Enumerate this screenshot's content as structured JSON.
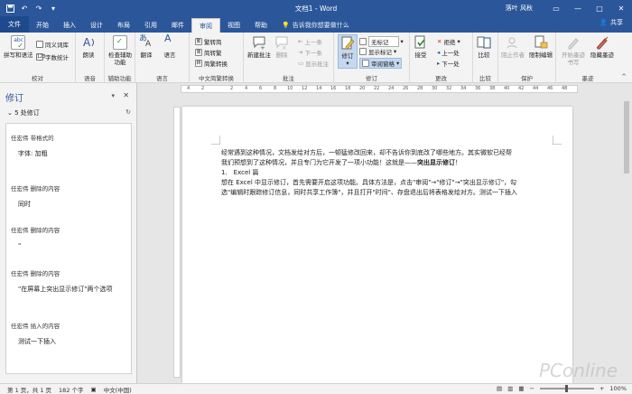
{
  "window": {
    "title": "文档1 - Word",
    "user": "落叶 风秋",
    "share_label": "共享",
    "tell_me": "告诉我你想要做什么"
  },
  "tabs": [
    "文件",
    "开始",
    "插入",
    "设计",
    "布局",
    "引用",
    "邮件",
    "审阅",
    "视图",
    "帮助"
  ],
  "active_tab": "审阅",
  "ribbon": {
    "proofing": {
      "name": "校对",
      "spelling": "拼写和语法",
      "thesaurus": "同义词库",
      "wordcount": "字数统计"
    },
    "speech": {
      "name": "语音",
      "read_aloud": "朗读"
    },
    "accessibility": {
      "name": "辅助功能",
      "check": "检查辅助功能"
    },
    "language": {
      "name": "语言",
      "translate": "翻译",
      "language": "语言"
    },
    "chinese": {
      "name": "中文简繁转换",
      "to_trad": "繁转简",
      "to_simp": "简转繁",
      "convert": "简繁转换"
    },
    "comments": {
      "name": "批注",
      "new": "新建批注",
      "delete": "删除",
      "prev": "上一条",
      "next": "下一条",
      "show": "显示批注"
    },
    "tracking": {
      "name": "修订",
      "track": "修订",
      "markup_select": "无标记",
      "show_markup": "显示标记",
      "pane": "审阅窗格"
    },
    "changes": {
      "name": "更改",
      "accept": "接受",
      "reject": "拒绝",
      "prev": "上一处",
      "next": "下一处"
    },
    "compare": {
      "name": "比较",
      "compare": "比较"
    },
    "protect": {
      "name": "保护",
      "block": "阻止作者",
      "restrict": "限制编辑"
    },
    "ink": {
      "name": "墨迹",
      "start": "开始墨迹书写",
      "hide": "隐藏墨迹"
    }
  },
  "pane": {
    "title": "修订",
    "count": "5 处修订",
    "revisions": [
      {
        "header": "任宏伟 带格式的",
        "content": "字体: 加粗"
      },
      {
        "header": "任宏伟 删除的内容",
        "content": "同时"
      },
      {
        "header": "任宏伟 删除的内容",
        "content": "\""
      },
      {
        "header": "任宏伟 删除的内容",
        "content": "\"在屏幕上突出显示修订\"两个选项"
      },
      {
        "header": "任宏伟 插入的内容",
        "content": "测试一下插入"
      }
    ]
  },
  "ruler_marks": [
    "4",
    "2",
    "2",
    "4",
    "6",
    "8",
    "10",
    "12",
    "14",
    "16",
    "18",
    "20",
    "22",
    "24",
    "26",
    "28",
    "30",
    "32",
    "34",
    "36",
    "38",
    "40",
    "42",
    "44",
    "46",
    "48"
  ],
  "document": {
    "line1": "经常遇到这种情况，文档发给对方后，一顿猛修改回来，却不告诉你到底改了哪些地方。其实微软已经帮",
    "line2_pre": "我们预想到了这种情况，并且专门为它开发了一项小功能！这就是——",
    "line2_bold": "突出显示修订",
    "line2_post": "！",
    "line3": "1.　Excel 篇",
    "line4": "想在 Excel 中显示修订，首先需要开启这项功能。具体方法是，点击\"审阅\"→\"修订\"→\"突出显示修订\"，勾",
    "line5": "选\"编辑时跟踪修订信息，同时共享工作簿\"，并且打开\"时间\"、存盘退出后将表格发给对方。测试一下插入"
  },
  "status": {
    "page": "第 1 页，共 1 页",
    "words": "182 个字",
    "language": "中文(中国)",
    "zoom": "100%"
  },
  "watermark": "PConline",
  "colors": {
    "accent": "#2b579a"
  }
}
